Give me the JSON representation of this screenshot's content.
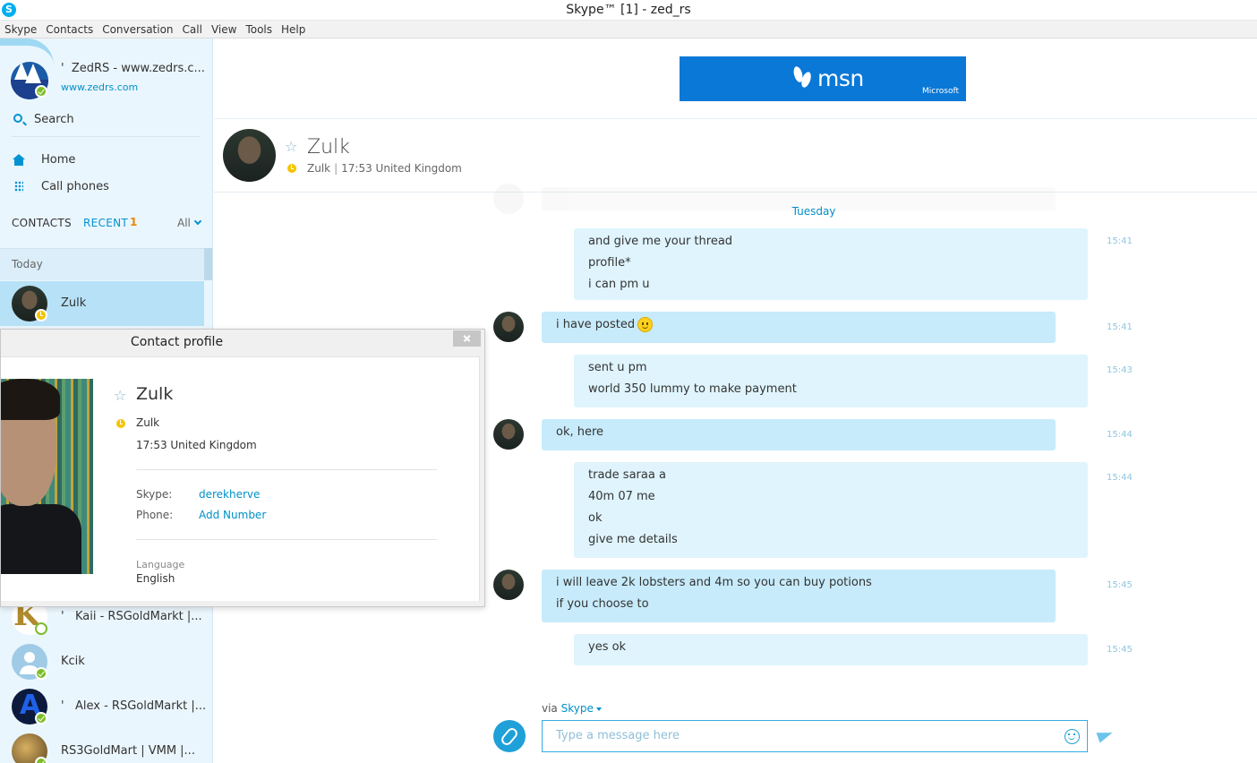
{
  "window": {
    "title": "Skype™ [1] - zed_rs",
    "app_icon": "S"
  },
  "menu": [
    "Skype",
    "Contacts",
    "Conversation",
    "Call",
    "View",
    "Tools",
    "Help"
  ],
  "me": {
    "name": "ZedRS - www.zedrs.c...",
    "name_prefix": "'",
    "mood": "www.zedrs.com"
  },
  "nav": {
    "search": "Search",
    "home": "Home",
    "call_phones": "Call phones"
  },
  "tabs": {
    "contacts": "CONTACTS",
    "recent": "RECENT",
    "recent_count": "1",
    "filter": "All"
  },
  "group_today": "Today",
  "contacts": [
    {
      "prefix": "",
      "name": "Zulk",
      "status": "away"
    },
    {
      "prefix": "'",
      "name": "Kaii - RSGoldMarkt |...",
      "status": "offline"
    },
    {
      "prefix": "",
      "name": "Kcik",
      "status": "online"
    },
    {
      "prefix": "'",
      "name": "Alex - RSGoldMarkt |...",
      "status": "online"
    },
    {
      "prefix": "",
      "name": "RS3GoldMart | VMM |...",
      "status": "online"
    }
  ],
  "ad": {
    "brand": "msn",
    "company": "Microsoft",
    "color": "#0a78d7"
  },
  "conversation": {
    "name": "Zulk",
    "handle": "Zulk",
    "separator": "|",
    "local_info": "17:53 United Kingdom",
    "day": "Tuesday",
    "messages": [
      {
        "from": "me",
        "lines": [
          "and give me your thread",
          "profile*",
          "i can pm u"
        ],
        "time": "15:41"
      },
      {
        "from": "them",
        "lines": [
          "i have posted"
        ],
        "emoji": "smiley",
        "time": "15:41"
      },
      {
        "from": "me",
        "lines": [
          "sent u pm",
          "world 350 lummy to make payment"
        ],
        "time": "15:43"
      },
      {
        "from": "them",
        "lines": [
          "ok, here"
        ],
        "time": "15:44"
      },
      {
        "from": "me",
        "lines": [
          "trade saraa a",
          "40m 07 me",
          "ok",
          "give me details"
        ],
        "time": "15:44"
      },
      {
        "from": "them",
        "lines": [
          "i will leave 2k lobsters and 4m so you can buy potions",
          "if you choose to"
        ],
        "time": "15:45"
      },
      {
        "from": "me",
        "lines": [
          "yes ok"
        ],
        "time": "15:45"
      }
    ],
    "via_label": "via",
    "via_service": "Skype",
    "input_placeholder": "Type a message here"
  },
  "profile_popup": {
    "title": "Contact profile",
    "name": "Zulk",
    "handle": "Zulk",
    "location": "17:53 United Kingdom",
    "skype_label": "Skype:",
    "skype_value": "derekherve",
    "phone_label": "Phone:",
    "phone_value": "Add Number",
    "language_label": "Language",
    "language_value": "English"
  },
  "colors": {
    "accent": "#00aff0",
    "bubble_them": "#c7ebfb",
    "bubble_me": "#dff4fd",
    "away": "#f5c400",
    "online": "#7cbd2a",
    "recent_count": "#f08200"
  }
}
